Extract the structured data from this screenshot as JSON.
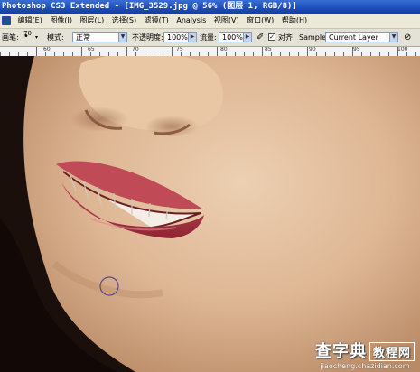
{
  "window": {
    "title": "Photoshop CS3 Extended - [IMG_3529.jpg @ 56% (图层 1, RGB/8)]"
  },
  "menubar": {
    "items": [
      "编辑(E)",
      "图像(I)",
      "图层(L)",
      "选择(S)",
      "滤镜(T)",
      "Analysis",
      "视图(V)",
      "窗口(W)",
      "帮助(H)"
    ]
  },
  "options": {
    "brush_label": "画笔:",
    "brush_size": "70",
    "mode_label": "模式:",
    "mode_value": "正常",
    "opacity_label": "不透明度:",
    "opacity_value": "100%",
    "flow_label": "流量:",
    "flow_value": "100%",
    "aligned_label": "对齐",
    "sample_label": "Sample:",
    "sample_value": "Current Layer"
  },
  "ruler": {
    "labels": [
      "60",
      "65",
      "70",
      "75",
      "80",
      "85",
      "90",
      "95",
      "100",
      "105"
    ]
  },
  "watermark": {
    "site_name": "查字典",
    "site_tag": "教程网",
    "url": "jiaocheng.chazidian.com"
  },
  "colors": {
    "titlebar": "#1c4fb8",
    "menubar": "#ece9d8",
    "skin": "#e0bd9a",
    "lips": "#b23a48",
    "hair": "#1b0f0b"
  }
}
